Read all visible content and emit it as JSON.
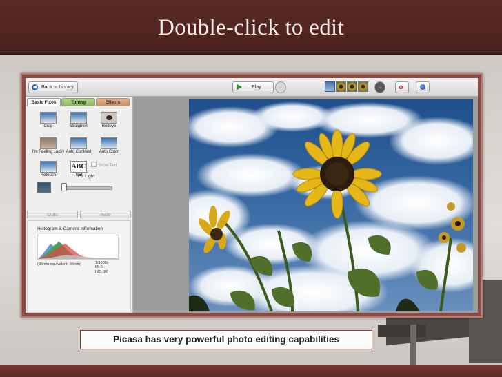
{
  "slide": {
    "title": "Double-click to edit",
    "caption": "Picasa has very powerful photo editing capabilities"
  },
  "toolbar": {
    "back_label": "Back to Library",
    "play_label": "Play",
    "back_icon": "back-arrow-icon",
    "play_icon": "play-icon",
    "prev_icon": "prev-arrow-icon",
    "next_icon": "next-arrow-icon",
    "thumbnail_count": 4
  },
  "panel": {
    "tabs": [
      "Basic Fixes",
      "Tuning",
      "Effects"
    ],
    "active_tab": "Basic Fixes",
    "tools": [
      {
        "label": "Crop"
      },
      {
        "label": "Straighten"
      },
      {
        "label": "Redeye"
      },
      {
        "label": "I'm Feeling Lucky"
      },
      {
        "label": "Auto Contrast"
      },
      {
        "label": "Auto Color"
      },
      {
        "label": "Retouch"
      },
      {
        "label": "Text",
        "icon_text": "ABC"
      }
    ],
    "show_text_label": "Show Text",
    "fill_light_label": "Fill Light",
    "fill_light_value": 0,
    "undo_label": "Undo",
    "redo_label": "Redo",
    "histogram_title": "Histogram & Camera Information",
    "camera_left": "(35mm equivalent:  96mm)",
    "camera_shutter": "1/1000s",
    "camera_fstop": "f/5.0",
    "camera_iso": "ISO: 80"
  },
  "colors": {
    "title_bar": "#4b211c",
    "caption_border": "#8b3a33",
    "tab_tuning": "#8cbc5a",
    "tab_effects": "#cf8e60"
  }
}
